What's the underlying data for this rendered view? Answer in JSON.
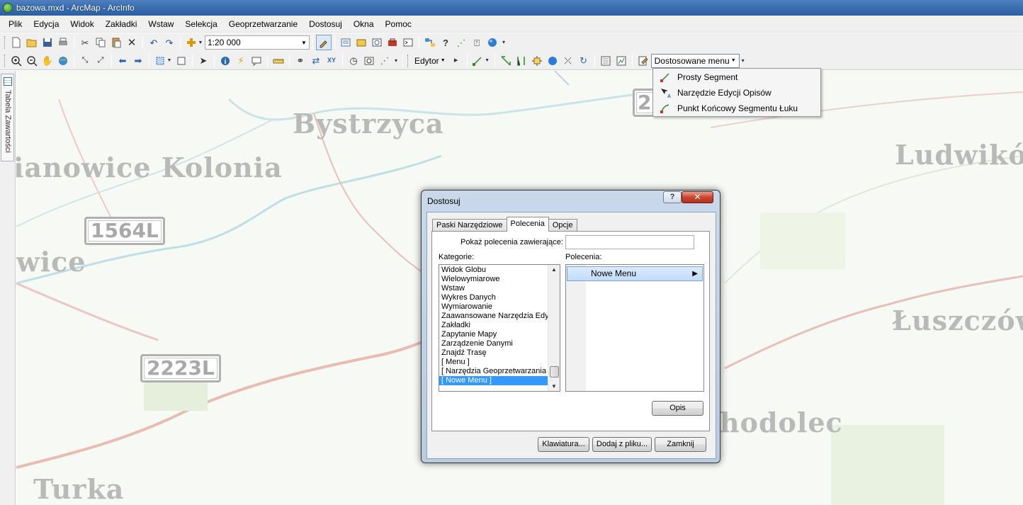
{
  "window": {
    "title": "bazowa.mxd - ArcMap - ArcInfo"
  },
  "menubar": [
    "Plik",
    "Edycja",
    "Widok",
    "Zakładki",
    "Wstaw",
    "Selekcja",
    "Geoprzetwarzanie",
    "Dostosuj",
    "Okna",
    "Pomoc"
  ],
  "toolbar": {
    "scale": "1:20 000",
    "editor_label": "Edytor",
    "custom_menu_label": "Dostosowane menu"
  },
  "toc": {
    "label": "Tabela Zawartości"
  },
  "map": {
    "places": [
      "Bystrzyca",
      "ianowice Kolonia",
      "wice",
      "Ludwików",
      "Łuszczów",
      "hodolec",
      "Turka",
      "2"
    ],
    "roads": [
      "1564L",
      "2223L"
    ]
  },
  "dropdown": {
    "items": [
      {
        "label": "Prosty Segment",
        "icon": "straight-segment-icon"
      },
      {
        "label": "Narzędzie Edycji Opisów",
        "icon": "edit-annotation-icon"
      },
      {
        "label": "Punkt Końcowy Segmentu Łuku",
        "icon": "endpoint-arc-icon"
      }
    ]
  },
  "dialog": {
    "title": "Dostosuj",
    "help": "?",
    "close": "✕",
    "tabs": [
      "Paski Narzędziowe",
      "Polecenia",
      "Opcje"
    ],
    "show_label": "Pokaż polecenia zawierające:",
    "show_value": "",
    "categories_label": "Kategorie:",
    "commands_label": "Polecenia:",
    "categories": [
      "Widok Globu",
      "Wielowymiarowe",
      "Wstaw",
      "Wykres Danych",
      "Wymiarowanie",
      "Zaawansowane Narzędzia Edycji",
      "Zakładki",
      "Zapytanie Mapy",
      "Zarządzenie Danymi",
      "Znajdź Trasę",
      "[ Menu ]",
      "[ Narzędzia Geoprzetwarzania ]",
      "[ Nowe Menu ]"
    ],
    "selected_category": "[ Nowe Menu ]",
    "commands": [
      {
        "label": "Nowe Menu",
        "submenu_arrow": "▶"
      }
    ],
    "buttons": {
      "opis": "Opis",
      "klawiatura": "Klawiatura...",
      "dodaj": "Dodaj z pliku...",
      "zamknij": "Zamknij"
    }
  }
}
